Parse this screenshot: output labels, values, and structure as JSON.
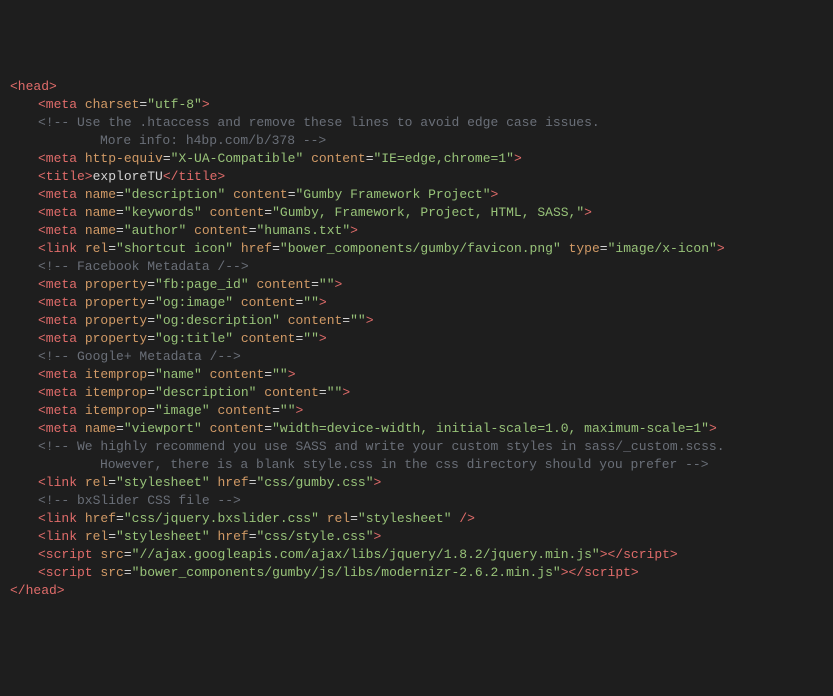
{
  "lines": [
    {
      "indent": 0,
      "tokens": [
        [
          "tag",
          "<head>"
        ]
      ]
    },
    {
      "indent": 1,
      "tokens": [
        [
          "tag",
          "<meta "
        ],
        [
          "attr",
          "charset"
        ],
        [
          "op",
          "="
        ],
        [
          "str",
          "\"utf-8\""
        ],
        [
          "tag",
          ">"
        ]
      ]
    },
    {
      "indent": 1,
      "tokens": [
        [
          "cmt",
          "<!-- Use the .htaccess and remove these lines to avoid edge case issues."
        ]
      ]
    },
    {
      "indent": 2,
      "tokens": [
        [
          "cmt",
          "More info: h4bp.com/b/378 -->"
        ]
      ]
    },
    {
      "indent": 1,
      "tokens": [
        [
          "tag",
          "<meta "
        ],
        [
          "attr",
          "http-equiv"
        ],
        [
          "op",
          "="
        ],
        [
          "str",
          "\"X-UA-Compatible\""
        ],
        [
          "txt",
          " "
        ],
        [
          "attr",
          "content"
        ],
        [
          "op",
          "="
        ],
        [
          "str",
          "\"IE=edge,chrome=1\""
        ],
        [
          "tag",
          ">"
        ]
      ]
    },
    {
      "indent": 1,
      "tokens": [
        [
          "tag",
          "<title>"
        ],
        [
          "txt",
          "exploreTU"
        ],
        [
          "tag",
          "</title>"
        ]
      ]
    },
    {
      "indent": 1,
      "tokens": [
        [
          "tag",
          "<meta "
        ],
        [
          "attr",
          "name"
        ],
        [
          "op",
          "="
        ],
        [
          "str",
          "\"description\""
        ],
        [
          "txt",
          " "
        ],
        [
          "attr",
          "content"
        ],
        [
          "op",
          "="
        ],
        [
          "str",
          "\"Gumby Framework Project\""
        ],
        [
          "tag",
          ">"
        ]
      ]
    },
    {
      "indent": 1,
      "tokens": [
        [
          "tag",
          "<meta "
        ],
        [
          "attr",
          "name"
        ],
        [
          "op",
          "="
        ],
        [
          "str",
          "\"keywords\""
        ],
        [
          "txt",
          " "
        ],
        [
          "attr",
          "content"
        ],
        [
          "op",
          "="
        ],
        [
          "str",
          "\"Gumby, Framework, Project, HTML, SASS,\""
        ],
        [
          "tag",
          ">"
        ]
      ]
    },
    {
      "indent": 1,
      "tokens": [
        [
          "tag",
          "<meta "
        ],
        [
          "attr",
          "name"
        ],
        [
          "op",
          "="
        ],
        [
          "str",
          "\"author\""
        ],
        [
          "txt",
          " "
        ],
        [
          "attr",
          "content"
        ],
        [
          "op",
          "="
        ],
        [
          "str",
          "\"humans.txt\""
        ],
        [
          "tag",
          ">"
        ]
      ]
    },
    {
      "indent": 1,
      "tokens": [
        [
          "tag",
          "<link "
        ],
        [
          "attr",
          "rel"
        ],
        [
          "op",
          "="
        ],
        [
          "str",
          "\"shortcut icon\""
        ],
        [
          "txt",
          " "
        ],
        [
          "attr",
          "href"
        ],
        [
          "op",
          "="
        ],
        [
          "str",
          "\"bower_components/gumby/favicon.png\""
        ],
        [
          "txt",
          " "
        ],
        [
          "attr",
          "type"
        ],
        [
          "op",
          "="
        ],
        [
          "str",
          "\"image/x-icon\""
        ],
        [
          "tag",
          ">"
        ]
      ]
    },
    {
      "indent": 1,
      "tokens": [
        [
          "cmt",
          "<!-- Facebook Metadata /-->"
        ]
      ]
    },
    {
      "indent": 1,
      "tokens": [
        [
          "tag",
          "<meta "
        ],
        [
          "attr",
          "property"
        ],
        [
          "op",
          "="
        ],
        [
          "str",
          "\"fb:page_id\""
        ],
        [
          "txt",
          " "
        ],
        [
          "attr",
          "content"
        ],
        [
          "op",
          "="
        ],
        [
          "str",
          "\"\""
        ],
        [
          "tag",
          ">"
        ]
      ]
    },
    {
      "indent": 1,
      "tokens": [
        [
          "tag",
          "<meta "
        ],
        [
          "attr",
          "property"
        ],
        [
          "op",
          "="
        ],
        [
          "str",
          "\"og:image\""
        ],
        [
          "txt",
          " "
        ],
        [
          "attr",
          "content"
        ],
        [
          "op",
          "="
        ],
        [
          "str",
          "\"\""
        ],
        [
          "tag",
          ">"
        ]
      ]
    },
    {
      "indent": 1,
      "tokens": [
        [
          "tag",
          "<meta "
        ],
        [
          "attr",
          "property"
        ],
        [
          "op",
          "="
        ],
        [
          "str",
          "\"og:description\""
        ],
        [
          "txt",
          " "
        ],
        [
          "attr",
          "content"
        ],
        [
          "op",
          "="
        ],
        [
          "str",
          "\"\""
        ],
        [
          "tag",
          ">"
        ]
      ]
    },
    {
      "indent": 1,
      "tokens": [
        [
          "tag",
          "<meta "
        ],
        [
          "attr",
          "property"
        ],
        [
          "op",
          "="
        ],
        [
          "str",
          "\"og:title\""
        ],
        [
          "txt",
          " "
        ],
        [
          "attr",
          "content"
        ],
        [
          "op",
          "="
        ],
        [
          "str",
          "\"\""
        ],
        [
          "tag",
          ">"
        ]
      ]
    },
    {
      "indent": 1,
      "tokens": [
        [
          "cmt",
          "<!-- Google+ Metadata /-->"
        ]
      ]
    },
    {
      "indent": 1,
      "tokens": [
        [
          "tag",
          "<meta "
        ],
        [
          "attr",
          "itemprop"
        ],
        [
          "op",
          "="
        ],
        [
          "str",
          "\"name\""
        ],
        [
          "txt",
          " "
        ],
        [
          "attr",
          "content"
        ],
        [
          "op",
          "="
        ],
        [
          "str",
          "\"\""
        ],
        [
          "tag",
          ">"
        ]
      ]
    },
    {
      "indent": 1,
      "tokens": [
        [
          "tag",
          "<meta "
        ],
        [
          "attr",
          "itemprop"
        ],
        [
          "op",
          "="
        ],
        [
          "str",
          "\"description\""
        ],
        [
          "txt",
          " "
        ],
        [
          "attr",
          "content"
        ],
        [
          "op",
          "="
        ],
        [
          "str",
          "\"\""
        ],
        [
          "tag",
          ">"
        ]
      ]
    },
    {
      "indent": 1,
      "tokens": [
        [
          "tag",
          "<meta "
        ],
        [
          "attr",
          "itemprop"
        ],
        [
          "op",
          "="
        ],
        [
          "str",
          "\"image\""
        ],
        [
          "txt",
          " "
        ],
        [
          "attr",
          "content"
        ],
        [
          "op",
          "="
        ],
        [
          "str",
          "\"\""
        ],
        [
          "tag",
          ">"
        ]
      ]
    },
    {
      "indent": 1,
      "tokens": [
        [
          "tag",
          "<meta "
        ],
        [
          "attr",
          "name"
        ],
        [
          "op",
          "="
        ],
        [
          "str",
          "\"viewport\""
        ],
        [
          "txt",
          " "
        ],
        [
          "attr",
          "content"
        ],
        [
          "op",
          "="
        ],
        [
          "str",
          "\"width=device-width, initial-scale=1.0, maximum-scale=1\""
        ],
        [
          "tag",
          ">"
        ]
      ]
    },
    {
      "indent": 1,
      "tokens": [
        [
          "cmt",
          "<!-- We highly recommend you use SASS and write your custom styles in sass/_custom.scss."
        ]
      ]
    },
    {
      "indent": 2,
      "tokens": [
        [
          "cmt",
          "However, there is a blank style.css in the css directory should you prefer -->"
        ]
      ]
    },
    {
      "indent": 1,
      "tokens": [
        [
          "tag",
          "<link "
        ],
        [
          "attr",
          "rel"
        ],
        [
          "op",
          "="
        ],
        [
          "str",
          "\"stylesheet\""
        ],
        [
          "txt",
          " "
        ],
        [
          "attr",
          "href"
        ],
        [
          "op",
          "="
        ],
        [
          "str",
          "\"css/gumby.css\""
        ],
        [
          "tag",
          ">"
        ]
      ]
    },
    {
      "indent": 1,
      "tokens": [
        [
          "cmt",
          "<!-- bxSlider CSS file -->"
        ]
      ]
    },
    {
      "indent": 1,
      "tokens": [
        [
          "tag",
          "<link "
        ],
        [
          "attr",
          "href"
        ],
        [
          "op",
          "="
        ],
        [
          "str",
          "\"css/jquery.bxslider.css\""
        ],
        [
          "txt",
          " "
        ],
        [
          "attr",
          "rel"
        ],
        [
          "op",
          "="
        ],
        [
          "str",
          "\"stylesheet\""
        ],
        [
          "tag",
          " />"
        ]
      ]
    },
    {
      "indent": 1,
      "tokens": [
        [
          "tag",
          "<link "
        ],
        [
          "attr",
          "rel"
        ],
        [
          "op",
          "="
        ],
        [
          "str",
          "\"stylesheet\""
        ],
        [
          "txt",
          " "
        ],
        [
          "attr",
          "href"
        ],
        [
          "op",
          "="
        ],
        [
          "str",
          "\"css/style.css\""
        ],
        [
          "tag",
          ">"
        ]
      ]
    },
    {
      "indent": 1,
      "tokens": [
        [
          "tag",
          "<script "
        ],
        [
          "attr",
          "src"
        ],
        [
          "op",
          "="
        ],
        [
          "str",
          "\"//ajax.googleapis.com/ajax/libs/jquery/1.8.2/jquery.min.js\""
        ],
        [
          "tag",
          "></script>"
        ]
      ]
    },
    {
      "indent": 1,
      "tokens": [
        [
          "tag",
          "<script "
        ],
        [
          "attr",
          "src"
        ],
        [
          "op",
          "="
        ],
        [
          "str",
          "\"bower_components/gumby/js/libs/modernizr-2.6.2.min.js\""
        ],
        [
          "tag",
          "></script>"
        ]
      ]
    },
    {
      "indent": 0,
      "tokens": [
        [
          "tag",
          "</head>"
        ]
      ]
    }
  ]
}
